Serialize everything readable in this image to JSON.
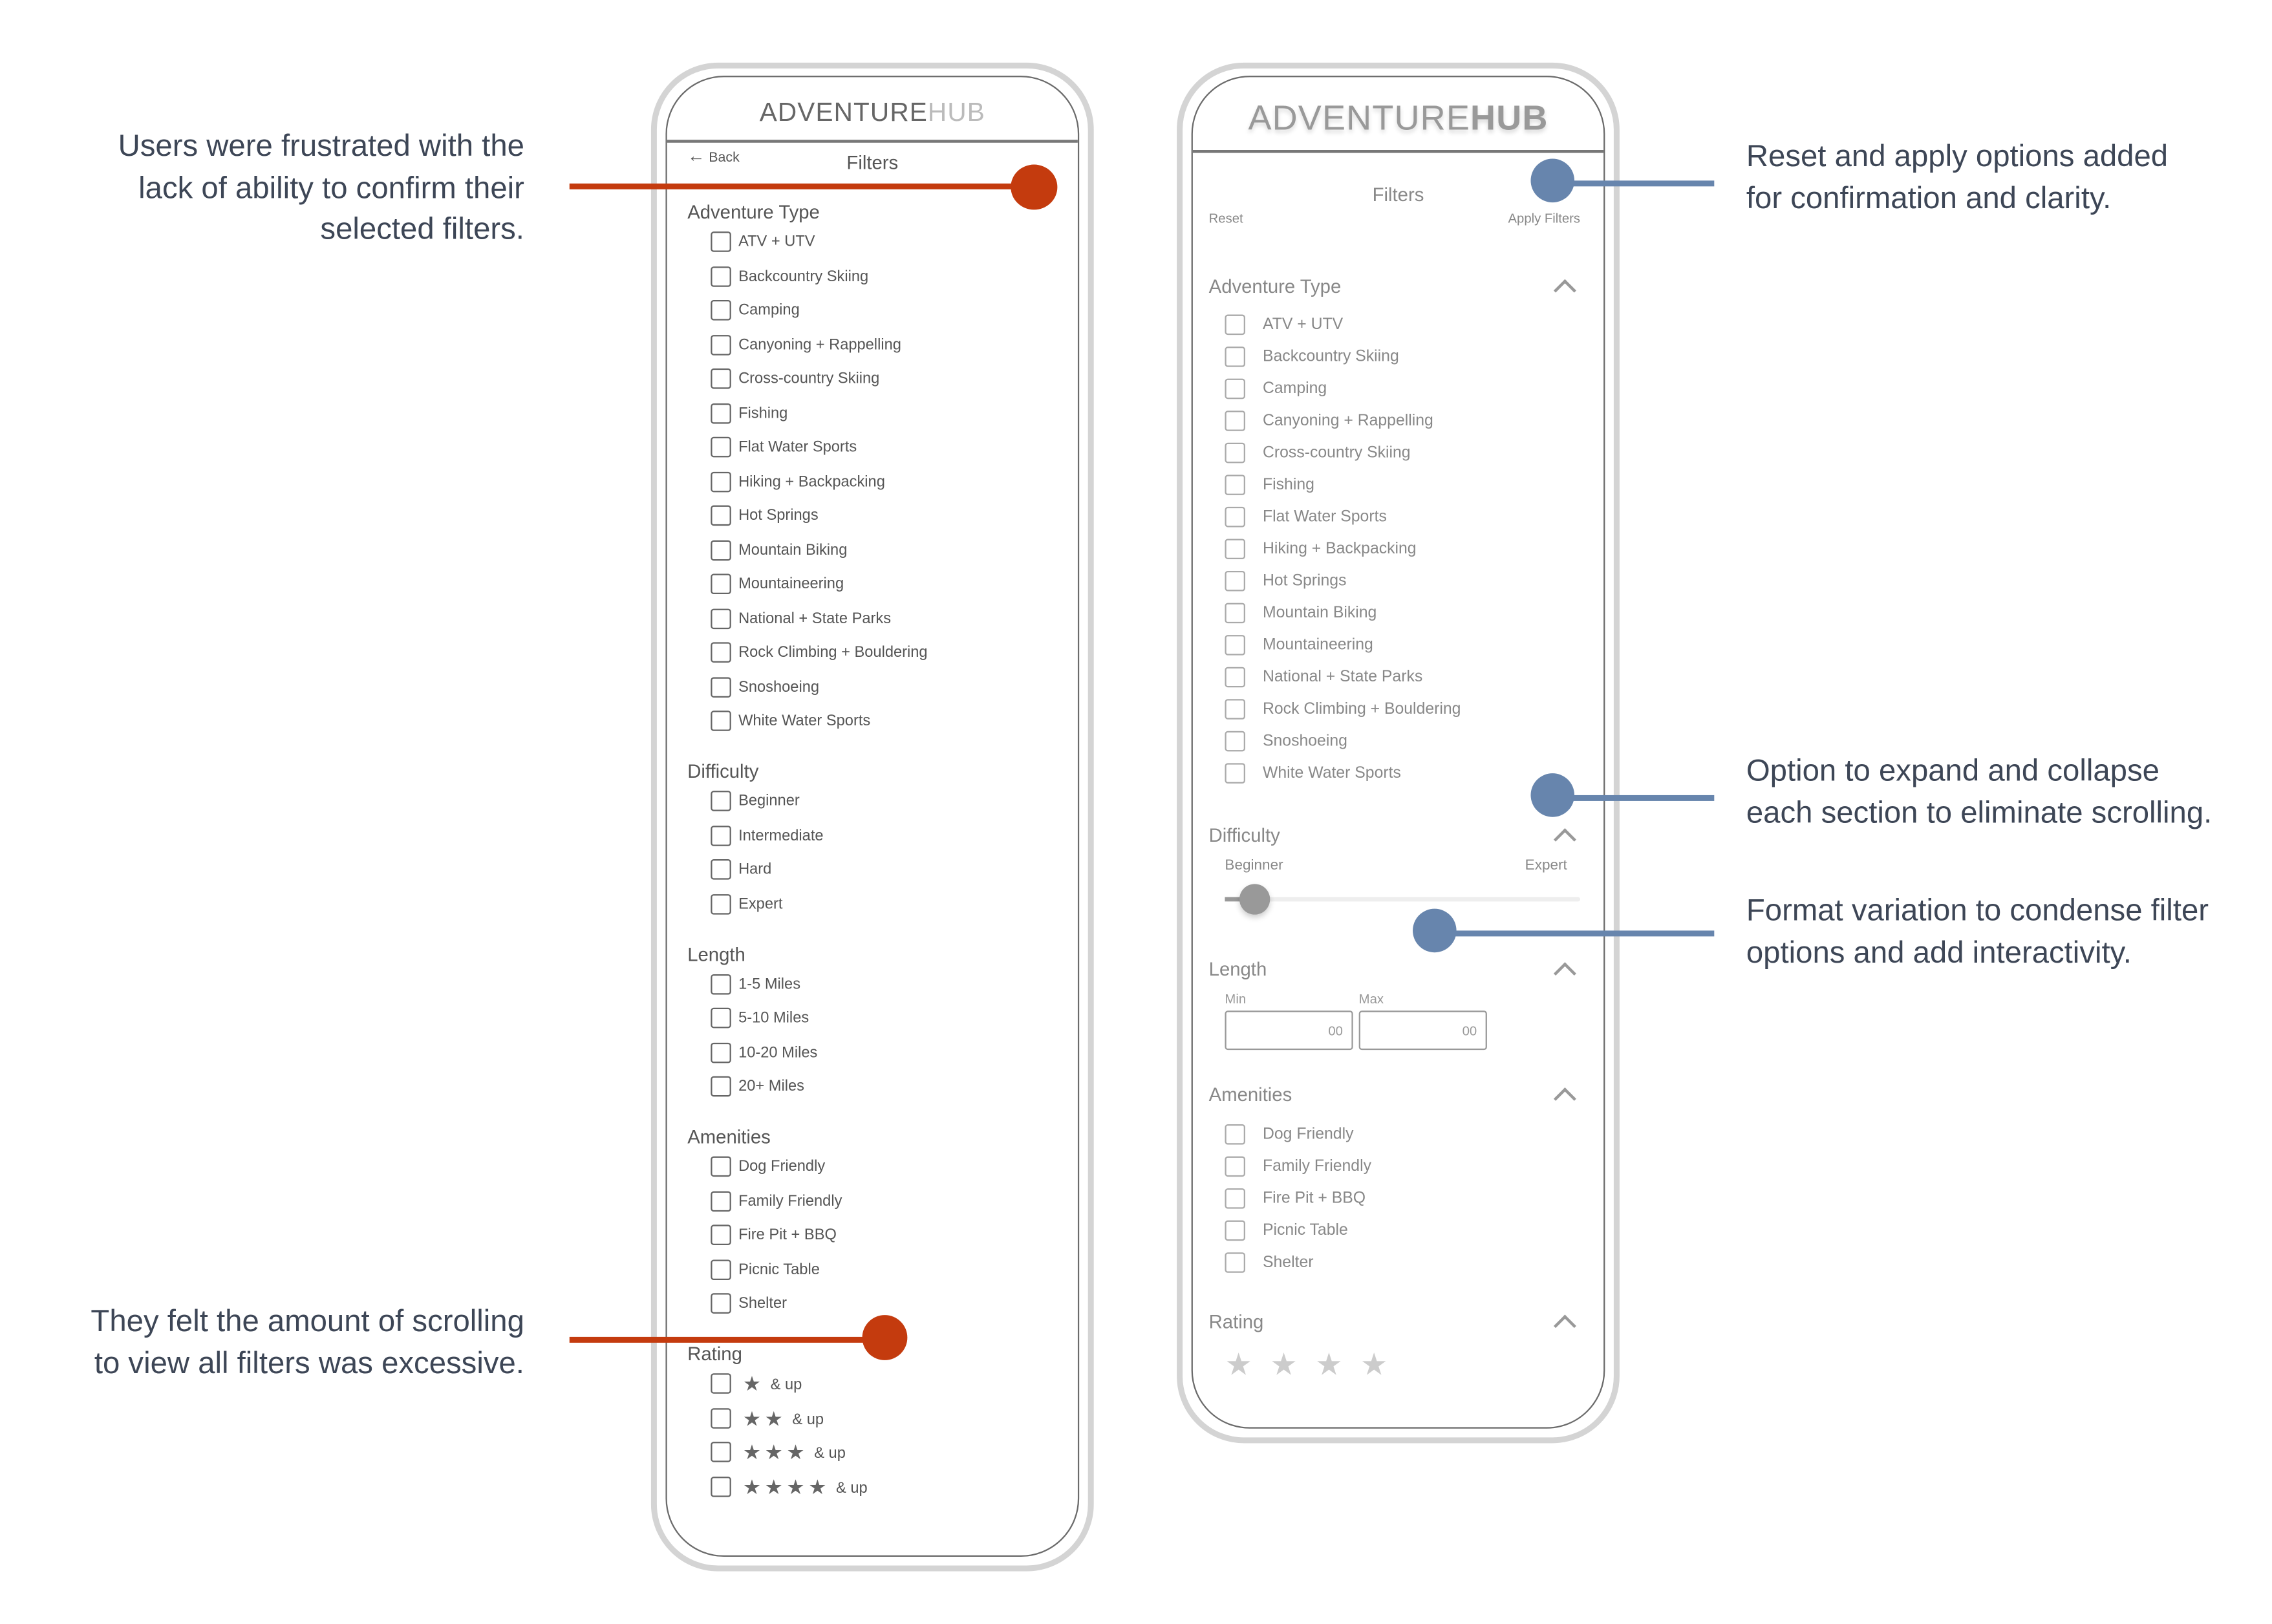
{
  "colors": {
    "red": "#c43b0e",
    "blue": "#6785ad"
  },
  "annotations": {
    "left_top": [
      "Users were frustrated with the",
      "lack of ability to confirm their",
      "selected filters."
    ],
    "left_bottom": [
      "They felt the amount of scrolling",
      "to view all filters was excessive."
    ],
    "right_1": [
      "Reset and apply options added",
      "for confirmation and clarity."
    ],
    "right_2": [
      "Option to expand and collapse",
      "each section to eliminate scrolling."
    ],
    "right_3": [
      "Format variation to condense filter",
      "options and add interactivity."
    ]
  },
  "old": {
    "logo_a": "ADVENTURE",
    "logo_b": "HUB",
    "back": "Back",
    "title": "Filters",
    "sections": [
      {
        "title": "Adventure Type",
        "items": [
          "ATV + UTV",
          "Backcountry Skiing",
          "Camping",
          "Canyoning + Rappelling",
          "Cross-country Skiing",
          "Fishing",
          "Flat Water Sports",
          "Hiking + Backpacking",
          "Hot Springs",
          "Mountain Biking",
          "Mountaineering",
          "National + State Parks",
          "Rock Climbing + Bouldering",
          "Snoshoeing",
          "White Water Sports"
        ]
      },
      {
        "title": "Difficulty",
        "items": [
          "Beginner",
          "Intermediate",
          "Hard",
          "Expert"
        ]
      },
      {
        "title": "Length",
        "items": [
          "1-5 Miles",
          "5-10 Miles",
          "10-20 Miles",
          "20+ Miles"
        ]
      },
      {
        "title": "Amenities",
        "items": [
          "Dog Friendly",
          "Family Friendly",
          "Fire Pit + BBQ",
          "Picnic Table",
          "Shelter"
        ]
      }
    ],
    "rating": {
      "title": "Rating",
      "suffix": "& up",
      "levels": [
        1,
        2,
        3,
        4
      ]
    }
  },
  "new": {
    "logo_a": "ADVENTURE",
    "logo_b": "HUB",
    "title": "Filters",
    "reset": "Reset",
    "apply": "Apply Filters",
    "adventure": {
      "title": "Adventure Type",
      "items": [
        "ATV + UTV",
        "Backcountry Skiing",
        "Camping",
        "Canyoning + Rappelling",
        "Cross-country Skiing",
        "Fishing",
        "Flat Water Sports",
        "Hiking + Backpacking",
        "Hot Springs",
        "Mountain Biking",
        "Mountaineering",
        "National + State Parks",
        "Rock Climbing + Bouldering",
        "Snoshoeing",
        "White Water Sports"
      ]
    },
    "difficulty": {
      "title": "Difficulty",
      "min_label": "Beginner",
      "max_label": "Expert",
      "value": 0.08
    },
    "length": {
      "title": "Length",
      "min_label": "Min",
      "max_label": "Max",
      "min_value": "00",
      "max_value": "00"
    },
    "amenities": {
      "title": "Amenities",
      "items": [
        "Dog Friendly",
        "Family Friendly",
        "Fire Pit + BBQ",
        "Picnic Table",
        "Shelter"
      ]
    },
    "rating": {
      "title": "Rating",
      "stars": 4
    }
  }
}
